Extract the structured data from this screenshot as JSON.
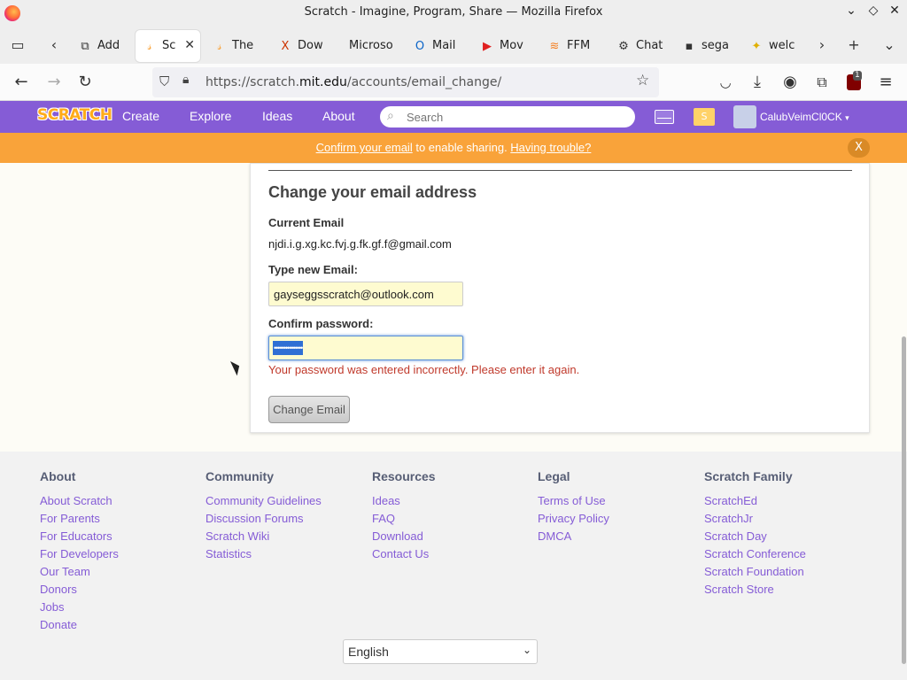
{
  "window": {
    "title": "Scratch - Imagine, Program, Share — Mozilla Firefox"
  },
  "tabs": [
    {
      "label": "Add",
      "icon": "puzzle-icon"
    },
    {
      "label": "Sc",
      "icon": "scratch-icon",
      "active": true
    },
    {
      "label": "The",
      "icon": "scratch-icon"
    },
    {
      "label": "Dow",
      "icon": "x-logo-icon"
    },
    {
      "label": "Microso",
      "icon": ""
    },
    {
      "label": "Mail",
      "icon": "outlook-icon"
    },
    {
      "label": "Mov",
      "icon": "youtube-icon"
    },
    {
      "label": "FFM",
      "icon": "stack-icon"
    },
    {
      "label": "Chat",
      "icon": "chatgpt-icon"
    },
    {
      "label": "sega",
      "icon": "terminal-icon"
    },
    {
      "label": "welc",
      "icon": "badge-icon"
    }
  ],
  "nav": {
    "url_prefix": "https://scratch.",
    "url_host": "mit.edu",
    "url_path": "/accounts/email_change/",
    "badge_count": "1"
  },
  "scratch": {
    "logo": "SCRATCH",
    "links": [
      "Create",
      "Explore",
      "Ideas",
      "About"
    ],
    "search_placeholder": "Search",
    "username": "CalubVeimCl0CK"
  },
  "banner": {
    "link1": "Confirm your email",
    "text": " to enable sharing. ",
    "link2": "Having trouble?",
    "close": "X"
  },
  "form": {
    "heading": "Change your email address",
    "current_label": "Current Email",
    "current_value": "njdi.i.g.xg.kc.fvj.g.fk.gf.f@gmail.com",
    "new_label": "Type new Email:",
    "new_value": "gayseggsscratch@outlook.com",
    "password_label": "Confirm password:",
    "password_mask": "•••••••••••••••",
    "error": "Your password was entered incorrectly. Please enter it again.",
    "submit": "Change Email"
  },
  "footer": {
    "columns": [
      {
        "title": "About",
        "links": [
          "About Scratch",
          "For Parents",
          "For Educators",
          "For Developers",
          "Our Team",
          "Donors",
          "Jobs",
          "Donate"
        ]
      },
      {
        "title": "Community",
        "links": [
          "Community Guidelines",
          "Discussion Forums",
          "Scratch Wiki",
          "Statistics"
        ]
      },
      {
        "title": "Resources",
        "links": [
          "Ideas",
          "FAQ",
          "Download",
          "Contact Us"
        ]
      },
      {
        "title": "Legal",
        "links": [
          "Terms of Use",
          "Privacy Policy",
          "DMCA"
        ]
      },
      {
        "title": "Scratch Family",
        "links": [
          "ScratchEd",
          "ScratchJr",
          "Scratch Day",
          "Scratch Conference",
          "Scratch Foundation",
          "Scratch Store"
        ]
      }
    ],
    "language": "English"
  }
}
